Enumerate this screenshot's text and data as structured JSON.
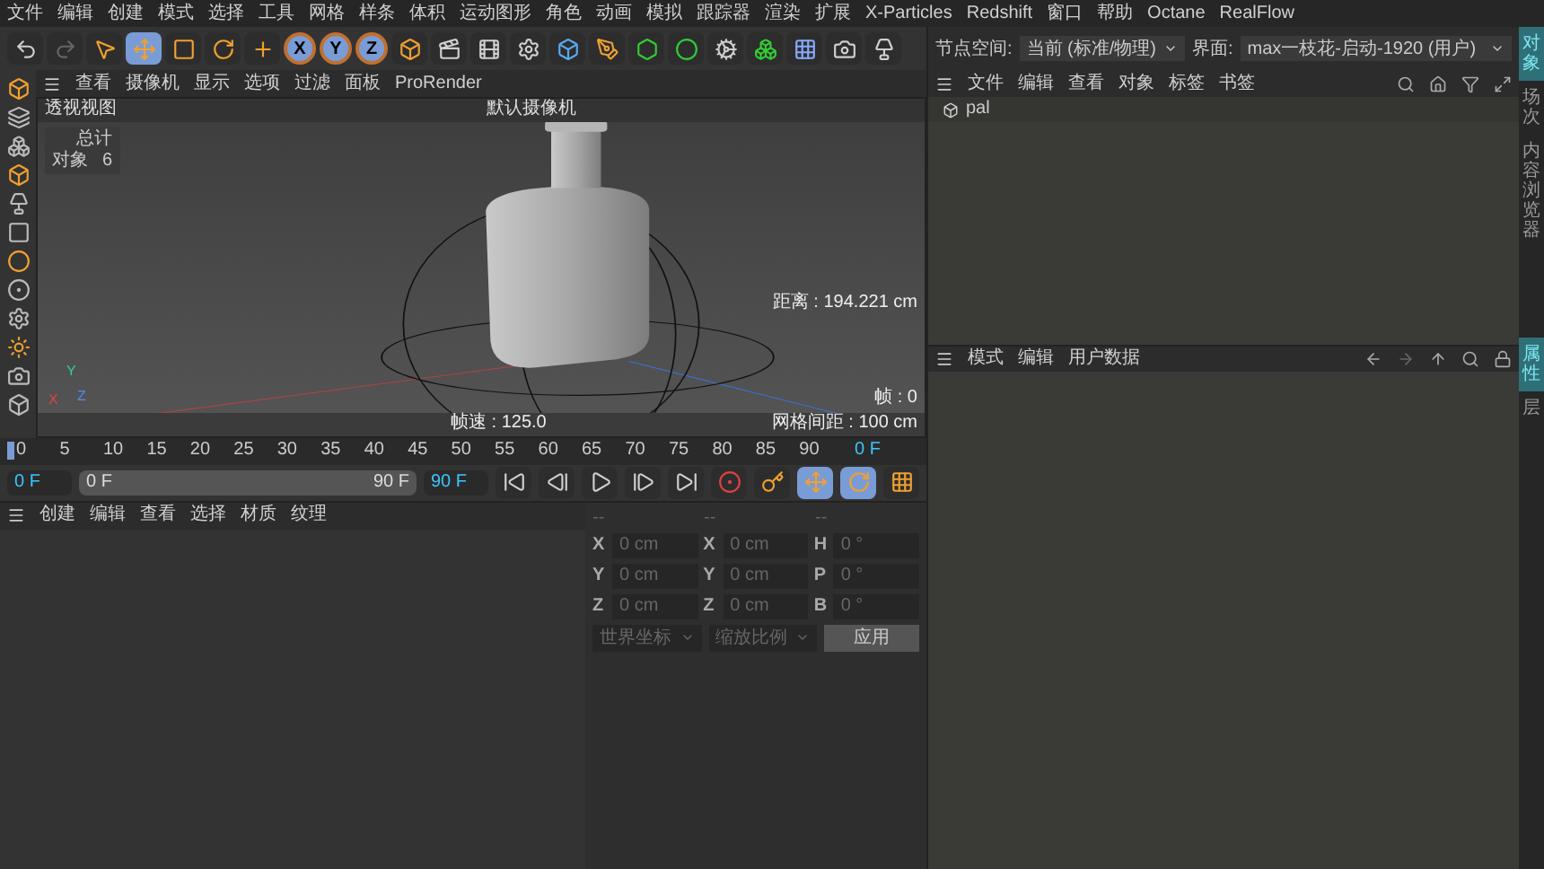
{
  "menu_bar": {
    "items": [
      "文件",
      "编辑",
      "创建",
      "模式",
      "选择",
      "工具",
      "网格",
      "样条",
      "体积",
      "运动图形",
      "角色",
      "动画",
      "模拟",
      "跟踪器",
      "渲染",
      "扩展",
      "X-Particles",
      "Redshift",
      "窗口",
      "帮助",
      "Octane",
      "RealFlow"
    ]
  },
  "node_space": {
    "label": "节点空间:",
    "value": "当前 (标准/物理)"
  },
  "layout": {
    "label": "界面:",
    "value": "max一枝花-启动-1920 (用户)"
  },
  "toolbar": {
    "axis_buttons": [
      "X",
      "Y",
      "Z"
    ]
  },
  "viewport": {
    "menu": [
      "查看",
      "摄像机",
      "显示",
      "选项",
      "过滤",
      "面板",
      "ProRender"
    ],
    "view_name": "透视视图",
    "camera": "默认摄像机",
    "stats": {
      "header": "总计",
      "label": "对象",
      "value": "6"
    },
    "distance": "距离 : 194.221 cm",
    "frame_rate": "帧速 : 125.0",
    "frame": "帧 : 0",
    "grid_spacing": "网格间距 : 100 cm",
    "axis_labels": [
      "X",
      "Y",
      "Z"
    ]
  },
  "timeline": {
    "ticks": [
      "0",
      "5",
      "10",
      "15",
      "20",
      "25",
      "30",
      "35",
      "40",
      "45",
      "50",
      "55",
      "60",
      "65",
      "70",
      "75",
      "80",
      "85",
      "90"
    ],
    "level": 0,
    "current_frame": "0 F",
    "start": "0 F",
    "range": {
      "start": "0 F",
      "end": "90 F",
      "level": 1
    },
    "end": "90 F"
  },
  "object_manager": {
    "menu": [
      "文件",
      "编辑",
      "查看",
      "对象",
      "标签",
      "书签"
    ],
    "objects": [
      {
        "name": "pal"
      }
    ]
  },
  "attribute_manager": {
    "menu": [
      "模式",
      "编辑",
      "用户数据"
    ]
  },
  "side_tabs_top": [
    {
      "label": "对象",
      "selected": true
    },
    {
      "label": "场次",
      "selected": false
    },
    {
      "label": "内容浏览器",
      "selected": false
    }
  ],
  "side_tabs_bottom": [
    {
      "label": "属性",
      "selected": true
    },
    {
      "label": "层",
      "selected": false
    }
  ],
  "material_manager": {
    "menu": [
      "创建",
      "编辑",
      "查看",
      "选择",
      "材质",
      "纹理"
    ]
  },
  "coordinates": {
    "disabled": true,
    "headers": [
      "--",
      "--",
      "--"
    ],
    "rows": [
      {
        "axis": "X",
        "position": "0 cm",
        "size_axis": "X",
        "size": "0 cm",
        "rot_axis": "H",
        "rotation": "0 °"
      },
      {
        "axis": "Y",
        "position": "0 cm",
        "size_axis": "Y",
        "size": "0 cm",
        "rot_axis": "P",
        "rotation": "0 °"
      },
      {
        "axis": "Z",
        "position": "0 cm",
        "size_axis": "Z",
        "size": "0 cm",
        "rot_axis": "B",
        "rotation": "0 °"
      }
    ],
    "space": "世界坐标",
    "scale_mode": "缩放比例",
    "apply": "应用"
  }
}
